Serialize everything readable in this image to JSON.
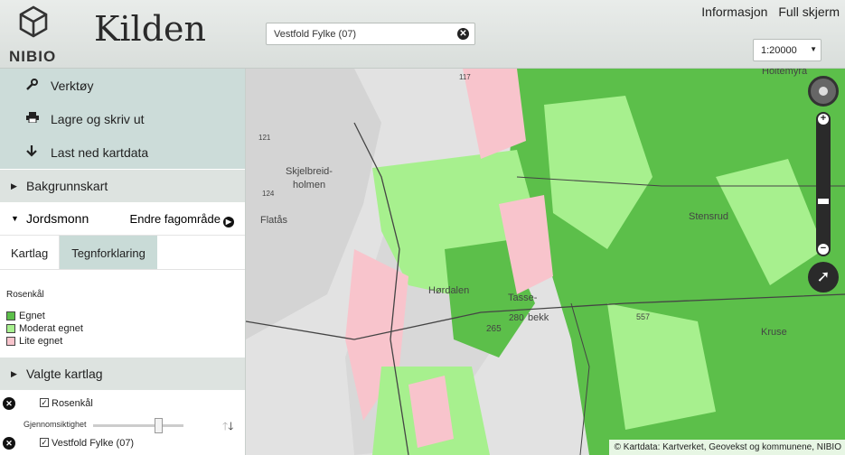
{
  "header": {
    "logo_text": "NIBIO",
    "app_title": "Kilden",
    "search_value": "Vestfold Fylke (07)",
    "links": [
      "Informasjon",
      "Full skjerm"
    ],
    "scale": "1:20000"
  },
  "sidebar": {
    "tools": [
      {
        "label": "Verktøy",
        "icon": "wrench-icon"
      },
      {
        "label": "Lagre og skriv ut",
        "icon": "print-icon"
      },
      {
        "label": "Last ned kartdata",
        "icon": "download-icon"
      }
    ],
    "background_maps": "Bakgrunnskart",
    "theme": {
      "label": "Jordsmonn",
      "change_label": "Endre fagområde"
    },
    "tabs": [
      {
        "label": "Kartlag",
        "active": false
      },
      {
        "label": "Tegnforklaring",
        "active": true
      }
    ],
    "legend": {
      "title": "Rosenkål",
      "items": [
        {
          "label": "Egnet",
          "color": "#5cbf4a"
        },
        {
          "label": "Moderat egnet",
          "color": "#a7f08e"
        },
        {
          "label": "Lite egnet",
          "color": "#f8c4cc"
        }
      ]
    },
    "selected_layers_label": "Valgte kartlag",
    "layers": [
      {
        "name": "Rosenkål",
        "checked": true
      },
      {
        "name": "Vestfold Fylke (07)",
        "checked": true
      }
    ],
    "opacity_label": "Gjennomsiktighet"
  },
  "map": {
    "place_names": [
      "Holtemyra",
      "Skjelbreid-",
      "holmen",
      "Flatås",
      "Hørdalen",
      "Tasse-",
      "bekk",
      "Stensrud",
      "Kruse"
    ],
    "elevations": [
      "117",
      "121",
      "124",
      "280",
      "265",
      "557"
    ],
    "attribution": "© Kartdata: Kartverket, Geovekst og kommunene, NIBIO"
  }
}
